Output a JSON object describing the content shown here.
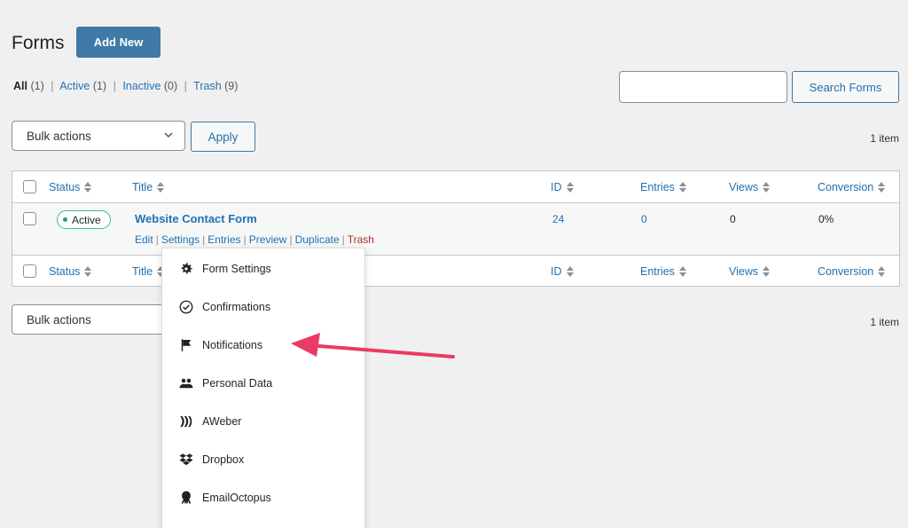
{
  "header": {
    "title": "Forms",
    "add_new_label": "Add New"
  },
  "filters": {
    "all": {
      "label": "All",
      "count": "(1)"
    },
    "active": {
      "label": "Active",
      "count": "(1)"
    },
    "inactive": {
      "label": "Inactive",
      "count": "(0)"
    },
    "trash": {
      "label": "Trash",
      "count": "(9)"
    },
    "separator": "|"
  },
  "search": {
    "button_label": "Search Forms",
    "value": ""
  },
  "bulk_top": {
    "selected": "Bulk actions",
    "apply_label": "Apply",
    "items_count": "1 item"
  },
  "bulk_bottom": {
    "selected": "Bulk actions",
    "items_count": "1 item"
  },
  "table": {
    "columns": [
      "Status",
      "Title",
      "ID",
      "Entries",
      "Views",
      "Conversion"
    ],
    "rows": [
      {
        "status": "Active",
        "title": "Website Contact Form",
        "id": "24",
        "entries": "0",
        "views": "0",
        "conversion": "0%",
        "actions": [
          "Edit",
          "Settings",
          "Entries",
          "Preview",
          "Duplicate",
          "Trash"
        ]
      }
    ]
  },
  "settings_menu": {
    "items": [
      {
        "label": "Form Settings",
        "icon": "gear-icon"
      },
      {
        "label": "Confirmations",
        "icon": "check-circle-icon"
      },
      {
        "label": "Notifications",
        "icon": "flag-icon"
      },
      {
        "label": "Personal Data",
        "icon": "users-icon"
      },
      {
        "label": "AWeber",
        "icon": "aweber-icon"
      },
      {
        "label": "Dropbox",
        "icon": "dropbox-icon"
      },
      {
        "label": "EmailOctopus",
        "icon": "octopus-icon"
      }
    ]
  },
  "colors": {
    "primary": "#2271b1",
    "button_blue": "#3e7aa5",
    "active_green": "#22a55b",
    "trash_red": "#b32d2e",
    "arrow_pink": "#e93b63"
  }
}
